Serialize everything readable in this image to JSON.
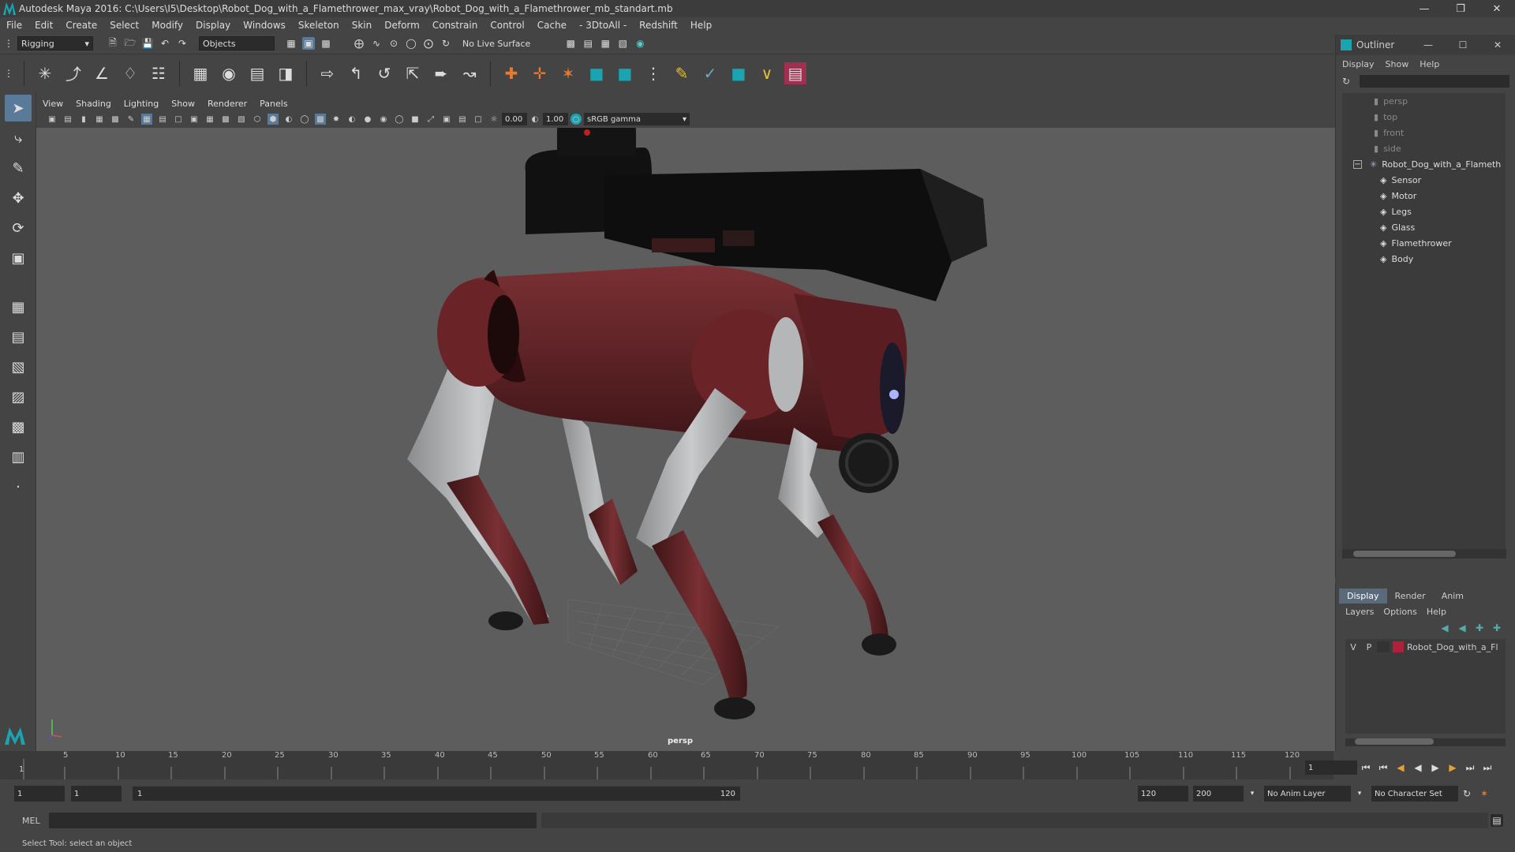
{
  "window": {
    "title": "Autodesk Maya 2016: C:\\Users\\I5\\Desktop\\Robot_Dog_with_a_Flamethrower_max_vray\\Robot_Dog_with_a_Flamethrower_mb_standart.mb"
  },
  "menubar": [
    "File",
    "Edit",
    "Create",
    "Select",
    "Modify",
    "Display",
    "Windows",
    "Skeleton",
    "Skin",
    "Deform",
    "Constrain",
    "Control",
    "Cache",
    "- 3DtoAll -",
    "Redshift",
    "Help"
  ],
  "statusline": {
    "mode": "Rigging",
    "selection_mode": "Objects",
    "live_surface": "No Live Surface"
  },
  "panel": {
    "menus": [
      "View",
      "Shading",
      "Lighting",
      "Show",
      "Renderer",
      "Panels"
    ],
    "exposure": "0.00",
    "gamma": "1.00",
    "colorspace": "sRGB gamma",
    "camera_label": "persp"
  },
  "outliner": {
    "title": "Outliner",
    "menus": [
      "Display",
      "Show",
      "Help"
    ],
    "cameras": [
      "persp",
      "top",
      "front",
      "side"
    ],
    "root": "Robot_Dog_with_a_Flameth",
    "children": [
      "Sensor",
      "Motor",
      "Legs",
      "Glass",
      "Flamethrower",
      "Body"
    ]
  },
  "layers": {
    "tabs": [
      "Display",
      "Render",
      "Anim"
    ],
    "menus": [
      "Layers",
      "Options",
      "Help"
    ],
    "v": "V",
    "p": "P",
    "layer_name": "Robot_Dog_with_a_Fl",
    "layer_color": "#b0203a"
  },
  "timeline": {
    "ticks": [
      "5",
      "10",
      "15",
      "20",
      "25",
      "30",
      "35",
      "40",
      "45",
      "50",
      "55",
      "60",
      "65",
      "70",
      "75",
      "80",
      "85",
      "90",
      "95",
      "100",
      "105",
      "110",
      "115",
      "120"
    ],
    "start_tick": "1",
    "current_frame": "1"
  },
  "range": {
    "start": "1",
    "current": "1",
    "slider_start": "1",
    "slider_end": "120",
    "end": "120",
    "max": "200",
    "anim_layer": "No Anim Layer",
    "character_set": "No Character Set"
  },
  "cmdline": {
    "label": "MEL"
  },
  "helpline": {
    "text": "Select Tool: select an object"
  },
  "colors": {
    "body": "#5a2024",
    "leg_gray": "#b4b6b8",
    "flamethrower": "#111111",
    "accent": "#1aa3b0"
  }
}
